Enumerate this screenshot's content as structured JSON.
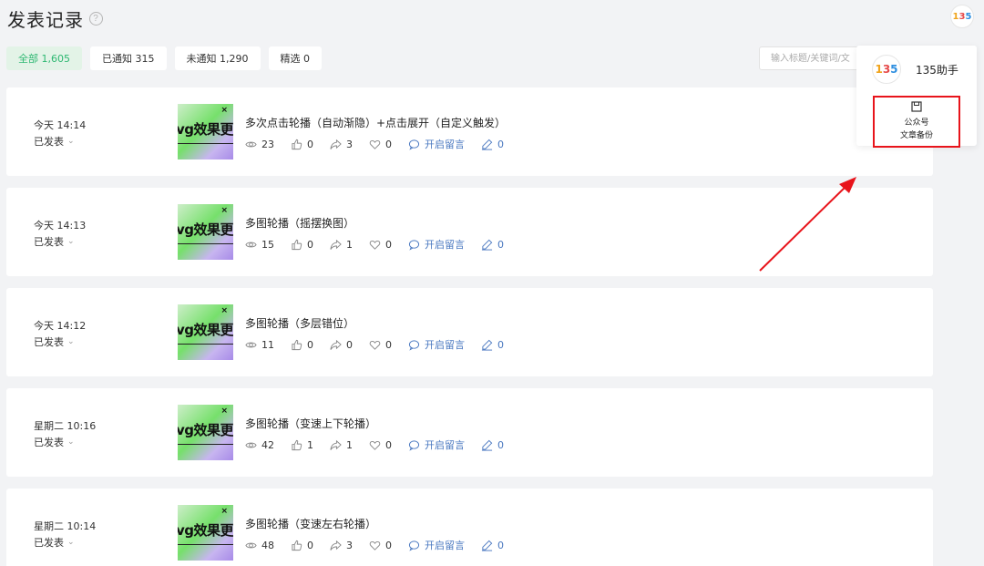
{
  "page": {
    "title": "发表记录",
    "help_icon": "?"
  },
  "top_logo": {
    "text_1": "1",
    "text_3": "3",
    "text_5": "5"
  },
  "tabs": [
    {
      "label": "全部 1,605",
      "active": true
    },
    {
      "label": "已通知 315",
      "active": false
    },
    {
      "label": "未通知 1,290",
      "active": false
    },
    {
      "label": "精选 0",
      "active": false
    }
  ],
  "search": {
    "placeholder": "输入标题/关键词/文"
  },
  "popup": {
    "name": "135助手",
    "action_line1": "公众号",
    "action_line2": "文章备份"
  },
  "thumb_text": "vg效果更新",
  "thumb_mark": "×",
  "articles": [
    {
      "time": "今天 14:14",
      "status": "已发表",
      "title": "多次点击轮播（自动渐隐）+点击展开（自定义触发）",
      "views": "23",
      "likes": "0",
      "shares": "3",
      "favs": "0",
      "comment_label": "开启留言",
      "edits": "0"
    },
    {
      "time": "今天 14:13",
      "status": "已发表",
      "title": "多图轮播（摇摆换图）",
      "views": "15",
      "likes": "0",
      "shares": "1",
      "favs": "0",
      "comment_label": "开启留言",
      "edits": "0"
    },
    {
      "time": "今天 14:12",
      "status": "已发表",
      "title": "多图轮播（多层错位）",
      "views": "11",
      "likes": "0",
      "shares": "0",
      "favs": "0",
      "comment_label": "开启留言",
      "edits": "0"
    },
    {
      "time": "星期二 10:16",
      "status": "已发表",
      "title": "多图轮播（变速上下轮播）",
      "views": "42",
      "likes": "1",
      "shares": "1",
      "favs": "0",
      "comment_label": "开启留言",
      "edits": "0"
    },
    {
      "time": "星期二 10:14",
      "status": "已发表",
      "title": "多图轮播（变速左右轮播）",
      "views": "48",
      "likes": "0",
      "shares": "3",
      "favs": "0",
      "comment_label": "开启留言",
      "edits": "0"
    }
  ],
  "colors": {
    "accent_green": "#2eb872",
    "highlight_red": "#e8141b",
    "link_blue": "#4a78c0"
  }
}
